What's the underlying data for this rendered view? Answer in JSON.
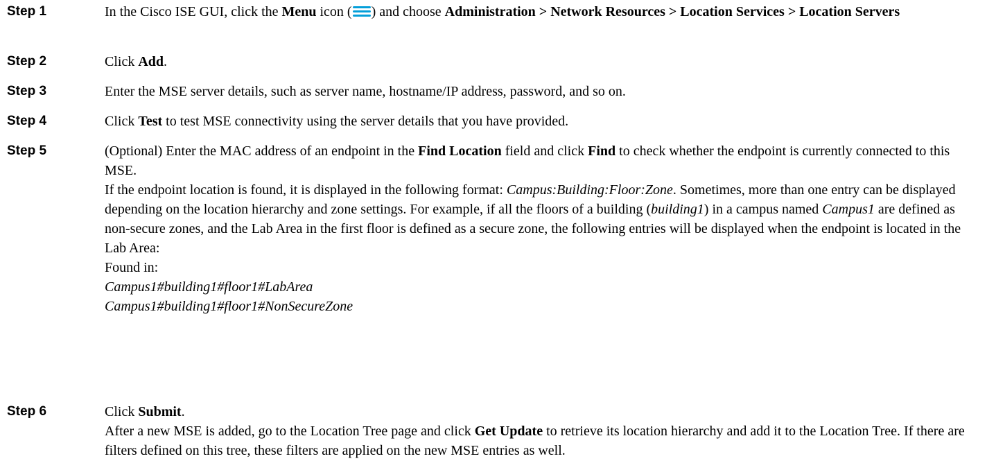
{
  "steps": [
    {
      "label": "Step 1",
      "text_before_menu": "In the Cisco ISE GUI, click the ",
      "menu_bold": "Menu",
      "icon_open": " icon (",
      "icon_close": ") and choose ",
      "path_bold": "Administration > Network Resources > Location Services > Location Servers"
    },
    {
      "label": "Step 2",
      "prefix": "Click ",
      "bold": "Add",
      "suffix": "."
    },
    {
      "label": "Step 3",
      "text": "Enter the MSE server details, such as server name, hostname/IP address, password, and so on."
    },
    {
      "label": "Step 4",
      "prefix": "Click ",
      "bold": "Test",
      "suffix": " to test MSE connectivity using the server details that you have provided."
    },
    {
      "label": "Step 5",
      "prefix": "(Optional) Enter the MAC address of an endpoint in the ",
      "bold1": "Find Location",
      "middle": " field and click ",
      "bold2": "Find",
      "suffix": " to check whether the endpoint is currently connected to this MSE.",
      "para_prefix": "If the endpoint location is found, it is displayed in the following format: ",
      "para_format": "Campus:Building:Floor:Zone",
      "para_mid1": ". Sometimes, more than one entry can be displayed depending on the location hierarchy and zone settings. For example, if all the floors of a building (",
      "para_building": "building1",
      "para_mid2": ") in a campus named ",
      "para_campus": "Campus1",
      "para_suffix": " are defined as non-secure zones, and the Lab Area in the first floor is defined as a secure zone, the following entries will be displayed when the endpoint is located in the Lab Area:",
      "found_in": "Found in:",
      "entry1": "Campus1#building1#floor1#LabArea",
      "entry2": "Campus1#building1#floor1#NonSecureZone"
    },
    {
      "label": "Step 6",
      "prefix": "Click ",
      "bold": "Submit",
      "suffix": ".",
      "note_prefix": "After a new MSE is added, go to the Location Tree page and click ",
      "note_bold": "Get Update",
      "note_suffix": " to retrieve its location hierarchy and add it to the Location Tree. If there are filters defined on this tree, these filters are applied on the new MSE entries as well."
    }
  ],
  "colors": {
    "menu_icon": "#049fd9"
  },
  "icons": {
    "menu": "menu-icon"
  }
}
